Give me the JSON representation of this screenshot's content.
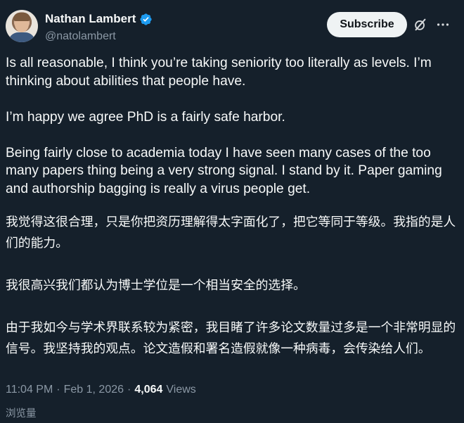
{
  "author": {
    "display_name": "Nathan Lambert",
    "handle": "@natolambert",
    "verified": true
  },
  "actions": {
    "subscribe_label": "Subscribe",
    "grok_icon": "grok-slash-icon",
    "more_icon": "more-dots-icon"
  },
  "tweet": {
    "en": [
      "Is all reasonable, I think you’re taking seniority too literally as levels. I’m thinking about abilities that people have.",
      "I’m happy we agree PhD is a fairly safe harbor.",
      "Being fairly close to academia today I have seen many cases of the too many papers thing being a very strong signal. I stand by it. Paper gaming and authorship bagging is really a virus people get."
    ],
    "zh": [
      "我觉得这很合理，只是你把资历理解得太字面化了，把它等同于等级。我指的是人们的能力。",
      "我很高兴我们都认为博士学位是一个相当安全的选择。",
      "由于我如今与学术界联系较为紧密，我目睹了许多论文数量过多是一个非常明显的信号。我坚持我的观点。论文造假和署名造假就像一种病毒，会传染给人们。"
    ]
  },
  "meta": {
    "time": "11:04 PM",
    "separator": "·",
    "date": "Feb 1, 2026",
    "views_count": "4,064",
    "views_label": "Views",
    "views_label_zh": "浏览量"
  },
  "colors": {
    "background": "#15202b",
    "text": "#f7f9f9",
    "secondary": "#8b98a5",
    "verified": "#1d9bf0",
    "button_bg": "#eff3f4"
  }
}
